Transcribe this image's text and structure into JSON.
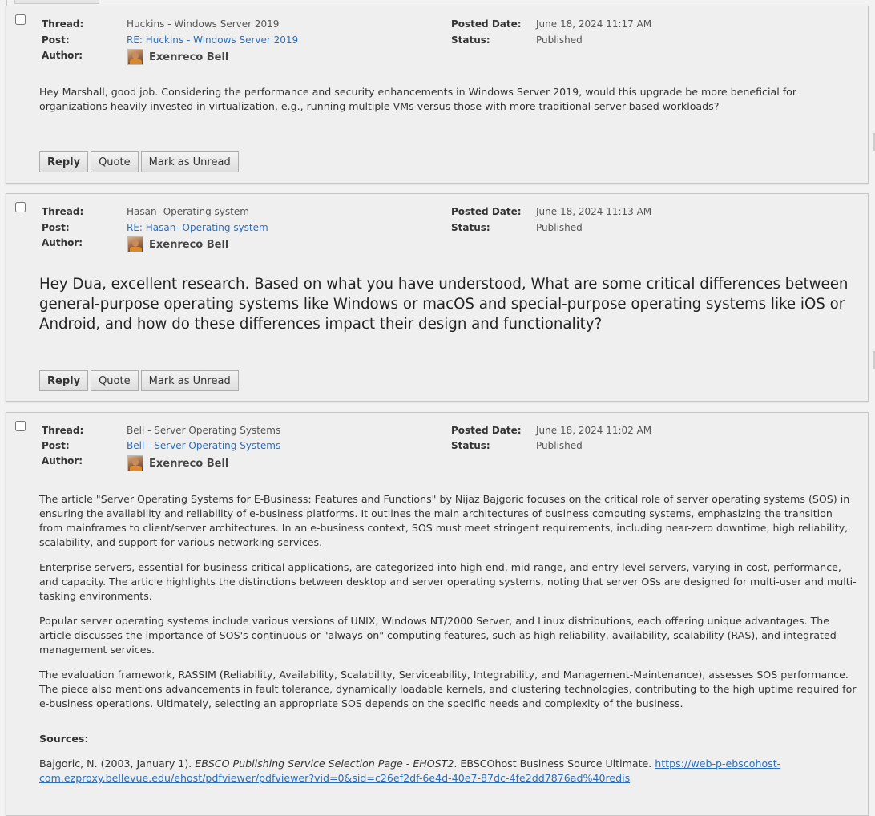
{
  "labels": {
    "thread": "Thread:",
    "post": "Post:",
    "author": "Author:",
    "posted_date": "Posted Date:",
    "status": "Status:"
  },
  "buttons": {
    "reply": "Reply",
    "quote": "Quote",
    "mark_unread": "Mark as Unread"
  },
  "posts": [
    {
      "thread": "Huckins - Windows Server 2019",
      "post": "RE: Huckins - Windows Server 2019",
      "author": "Exenreco Bell",
      "posted_date": "June 18, 2024 11:17 AM",
      "status": "Published",
      "body": [
        "Hey Marshall, good job. Considering the performance and security enhancements in Windows Server 2019, would this upgrade be more beneficial for organizations heavily invested in virtualization, e.g., running multiple VMs versus those with more traditional server-based workloads?"
      ]
    },
    {
      "thread": "Hasan- Operating system",
      "post": "RE: Hasan- Operating system",
      "author": "Exenreco Bell",
      "posted_date": "June 18, 2024 11:13 AM",
      "status": "Published",
      "body": [
        "Hey Dua, excellent research. Based on what you have understood, What are some critical differences between general-purpose operating systems like Windows or macOS and special-purpose operating systems like iOS or Android, and how do these differences impact their design and functionality?"
      ]
    },
    {
      "thread": "Bell - Server Operating Systems",
      "post": "Bell - Server Operating Systems",
      "author": "Exenreco Bell",
      "posted_date": "June 18, 2024 11:02 AM",
      "status": "Published",
      "body": [
        "The article \"Server Operating Systems for E-Business: Features and Functions\" by Nijaz Bajgoric focuses on the critical role of server operating systems (SOS) in ensuring the availability and reliability of e-business platforms. It outlines the main architectures of business computing systems, emphasizing the transition from mainframes to client/server architectures. In an e-business context, SOS must meet stringent requirements, including near-zero downtime, high reliability, scalability, and support for various networking services.",
        "Enterprise servers, essential for business-critical applications, are categorized into high-end, mid-range, and entry-level servers, varying in cost, performance, and capacity. The article highlights the distinctions between desktop and server operating systems, noting that server OSs are designed for multi-user and multi-tasking environments.",
        "Popular server operating systems include various versions of UNIX, Windows NT/2000 Server, and Linux distributions, each offering unique advantages. The article discusses the importance of SOS's continuous or \"always-on\" computing features, such as high reliability, availability, scalability (RAS), and integrated management services.",
        "The evaluation framework, RASSIM (Reliability, Availability, Scalability, Serviceability, Integrability, and Management-Maintenance), assesses SOS performance. The piece also mentions advancements in fault tolerance, dynamically loadable kernels, and clustering technologies, contributing to the high uptime required for e-business operations. Ultimately, selecting an appropriate SOS depends on the specific needs and complexity of the business."
      ],
      "sources_label": "Sources",
      "sources_colon": ":",
      "source_citation_prefix": "Bajgoric, N. (2003, January 1). ",
      "source_citation_title": "EBSCO Publishing Service Selection Page - EHOST2",
      "source_citation_mid": ". EBSCOhost Business Source Ultimate. ",
      "source_link_line1": "https://web-p-ebscohost-",
      "source_link_line2": "com.ezproxy.bellevue.edu/ehost/pdfviewer/pdfviewer?vid=0&sid=c26ef2df-6e4d-40e7-87dc-4fe2dd7876ad%40redis"
    }
  ]
}
